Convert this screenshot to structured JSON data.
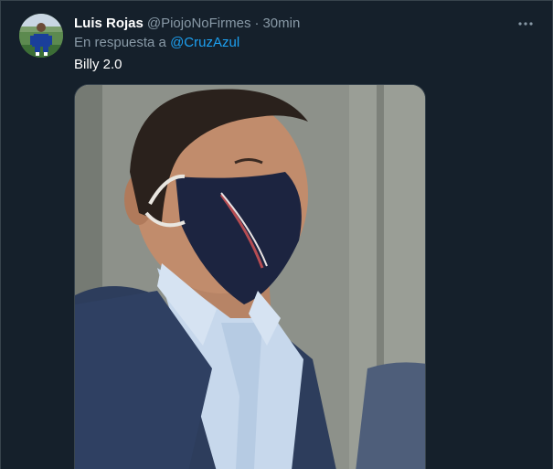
{
  "tweet": {
    "author_name": "Luis Rojas",
    "author_handle": "@PiojoNoFirmes",
    "separator": "·",
    "time": "30min",
    "reply_prefix": "En respuesta a",
    "reply_mention": "@CruzAzul",
    "text": "Billy 2.0",
    "more_icon": "more-horizontal-icon"
  },
  "colors": {
    "background": "#15202b",
    "border": "#38444d",
    "secondary_text": "#8899a6",
    "accent": "#1da1f2",
    "primary_text": "#ffffff"
  }
}
